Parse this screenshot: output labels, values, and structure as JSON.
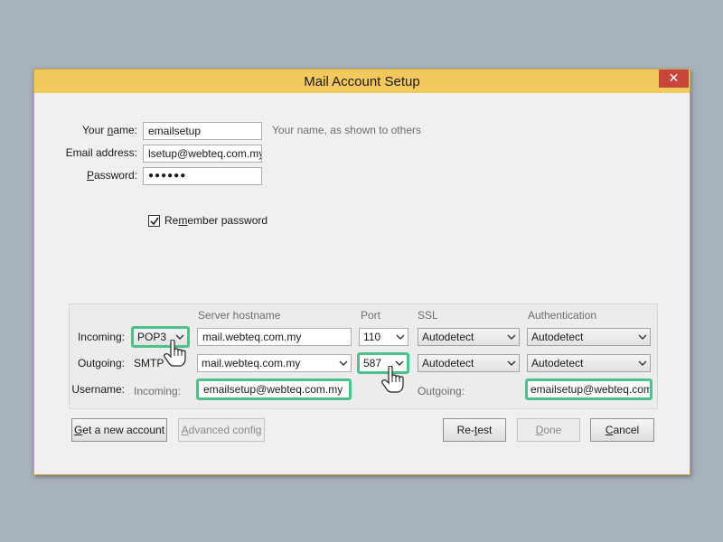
{
  "dialog": {
    "title": "Mail Account Setup",
    "close_glyph": "✕"
  },
  "account": {
    "name_label_prefix": "Your ",
    "name_label_u": "n",
    "name_label_suffix": "ame:",
    "name_value": "emailsetup",
    "name_hint": "Your name, as shown to others",
    "email_label": "Email address:",
    "email_value": "lsetup@webteq.com.my",
    "password_label_u": "P",
    "password_label_suffix": "assword:",
    "password_value": "●●●●●●",
    "remember_prefix": "Re",
    "remember_u": "m",
    "remember_suffix": "ember password",
    "remember_checked": true
  },
  "server": {
    "headers": {
      "hostname": "Server hostname",
      "port": "Port",
      "ssl": "SSL",
      "auth": "Authentication"
    },
    "incoming": {
      "label": "Incoming:",
      "protocol": "POP3",
      "hostname": "mail.webteq.com.my",
      "port": "110",
      "ssl": "Autodetect",
      "auth": "Autodetect"
    },
    "outgoing": {
      "label": "Outgoing:",
      "protocol": "SMTP",
      "hostname": "mail.webteq.com.my",
      "port": "587",
      "ssl": "Autodetect",
      "auth": "Autodetect"
    },
    "username": {
      "label": "Username:",
      "incoming_label": "Incoming:",
      "incoming_value": "emailsetup@webteq.com.my",
      "outgoing_label": "Outgoing:",
      "outgoing_value": "emailsetup@webteq.com"
    }
  },
  "buttons": {
    "new_account_u": "G",
    "new_account_rest": "et a new account",
    "advanced_u": "A",
    "advanced_rest": "dvanced config",
    "retest_prefix": "Re-",
    "retest_u": "t",
    "retest_suffix": "est",
    "done_u": "D",
    "done_rest": "one",
    "cancel_u": "C",
    "cancel_rest": "ancel"
  },
  "colors": {
    "titlebar": "#f1c95d",
    "close": "#c7463b",
    "highlight": "#4dc18a",
    "background": "#a8b2bb"
  },
  "icons": {
    "close": "close-icon",
    "dropdown": "chevron-down-icon",
    "cursor": "hand-pointer-icon",
    "check": "checkmark-icon"
  }
}
